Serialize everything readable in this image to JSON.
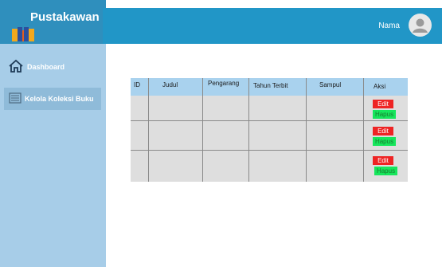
{
  "app": {
    "title": "Pustakawan"
  },
  "sidebar": {
    "items": [
      {
        "label": "Dashboard",
        "icon": "home-icon"
      },
      {
        "label": "Kelola Koleksi Buku",
        "icon": "book-list-icon"
      }
    ]
  },
  "header": {
    "user_name": "Nama"
  },
  "table": {
    "columns": [
      "ID",
      "Judul",
      "Pengarang",
      "Tahun Terbit",
      "Sampul",
      "Aksi"
    ],
    "rows": [
      {
        "edit": "Edit",
        "hapus": "Hapus"
      },
      {
        "edit": "Edit",
        "hapus": "Hapus"
      },
      {
        "edit": "Edit",
        "hapus": "Hapus"
      }
    ]
  },
  "colors": {
    "brand": "#2f8fbd",
    "topbar": "#2196c7",
    "sidebar": "#a7cde8",
    "table_header": "#a9d2ee",
    "edit": "#ee2424",
    "hapus": "#16e65c"
  }
}
